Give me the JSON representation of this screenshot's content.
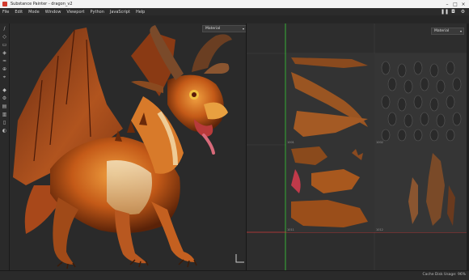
{
  "window": {
    "title": "Substance Painter - dragon_v2"
  },
  "menu": [
    "File",
    "Edit",
    "Mode",
    "Window",
    "Viewport",
    "Python",
    "JavaScript",
    "Help"
  ],
  "viewport3d": {
    "shading_mode": "Material"
  },
  "viewport2d": {
    "channel_mode": "Material",
    "tile_labels": [
      "1001",
      "1002",
      "1011",
      "1012"
    ]
  },
  "status": {
    "text": "Cache Disk Usage: 96%"
  },
  "colors": {
    "accent": "#d23b2e",
    "uv_vertical": "#3ad13a",
    "uv_horizontal": "#d13a3a"
  }
}
